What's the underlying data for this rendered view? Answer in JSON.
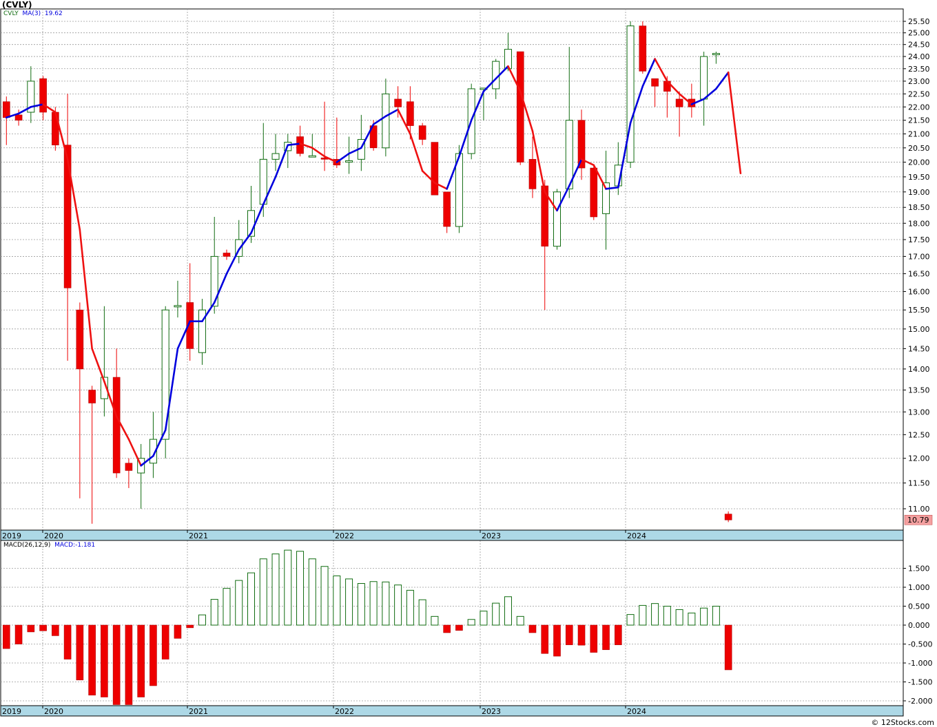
{
  "title": "(CVLY)",
  "credit": "© 12Stocks.com",
  "colors": {
    "up": "#0f6b0f",
    "down": "#ee0000",
    "ma_rising": "#0000dd",
    "ma_falling": "#ee1111",
    "axis_bar": "#add8e6",
    "price_box": "#f4a0a0"
  },
  "price_panel": {
    "legend_symbol": "CVLY",
    "legend_ma": "MA(3)",
    "legend_ma_value": "19.62",
    "last_price_label": "10.79",
    "y_ticks": [
      "25.50",
      "25.00",
      "24.50",
      "24.00",
      "23.50",
      "23.00",
      "22.50",
      "22.00",
      "21.50",
      "21.00",
      "20.50",
      "20.00",
      "19.50",
      "19.00",
      "18.50",
      "18.00",
      "17.50",
      "17.00",
      "16.50",
      "16.00",
      "15.50",
      "15.00",
      "14.50",
      "14.00",
      "13.50",
      "13.00",
      "12.50",
      "12.00",
      "11.50",
      "11.00"
    ]
  },
  "macd_panel": {
    "legend_name": "MACD(26,12,9)",
    "legend_value": "MACD:-1.181",
    "y_ticks": [
      "1.500",
      "1.000",
      "0.500",
      "0.000",
      "-0.500",
      "-1.000",
      "-1.500",
      "-2.000"
    ]
  },
  "x_labels": [
    "2019",
    "2020",
    "2021",
    "2022",
    "2023",
    "2024"
  ],
  "chart_data": {
    "type": "candlestick",
    "title": "(CVLY)",
    "price_scale": "log",
    "ylim": [
      10.7,
      25.8
    ],
    "candles": [
      {
        "o": 22.2,
        "h": 22.4,
        "l": 20.6,
        "c": 21.6
      },
      {
        "o": 21.7,
        "h": 21.9,
        "l": 21.3,
        "c": 21.5
      },
      {
        "o": 21.8,
        "h": 23.6,
        "l": 21.4,
        "c": 23.0
      },
      {
        "o": 23.1,
        "h": 23.2,
        "l": 21.5,
        "c": 21.8
      },
      {
        "o": 21.8,
        "h": 22.0,
        "l": 20.4,
        "c": 20.6
      },
      {
        "o": 20.6,
        "h": 22.5,
        "l": 14.2,
        "c": 16.1
      },
      {
        "o": 15.5,
        "h": 15.7,
        "l": 11.2,
        "c": 14.0
      },
      {
        "o": 13.5,
        "h": 13.6,
        "l": 10.2,
        "c": 13.2
      },
      {
        "o": 13.3,
        "h": 15.6,
        "l": 12.9,
        "c": 13.8
      },
      {
        "o": 13.8,
        "h": 14.5,
        "l": 11.6,
        "c": 11.7
      },
      {
        "o": 11.9,
        "h": 12.0,
        "l": 11.4,
        "c": 11.75
      },
      {
        "o": 11.7,
        "h": 12.3,
        "l": 11.0,
        "c": 12.0
      },
      {
        "o": 11.9,
        "h": 13.0,
        "l": 11.6,
        "c": 12.4
      },
      {
        "o": 12.4,
        "h": 15.6,
        "l": 12.0,
        "c": 15.5
      },
      {
        "o": 15.6,
        "h": 16.3,
        "l": 15.3,
        "c": 15.6
      },
      {
        "o": 15.7,
        "h": 16.8,
        "l": 14.2,
        "c": 14.5
      },
      {
        "o": 14.4,
        "h": 15.8,
        "l": 14.1,
        "c": 15.5
      },
      {
        "o": 15.6,
        "h": 18.2,
        "l": 15.4,
        "c": 17.0
      },
      {
        "o": 17.1,
        "h": 17.2,
        "l": 16.9,
        "c": 17.0
      },
      {
        "o": 17.0,
        "h": 18.1,
        "l": 16.8,
        "c": 17.5
      },
      {
        "o": 17.6,
        "h": 19.2,
        "l": 17.4,
        "c": 18.4
      },
      {
        "o": 18.6,
        "h": 21.4,
        "l": 18.2,
        "c": 20.1
      },
      {
        "o": 20.1,
        "h": 21.0,
        "l": 19.7,
        "c": 20.3
      },
      {
        "o": 20.4,
        "h": 21.0,
        "l": 19.8,
        "c": 20.7
      },
      {
        "o": 20.9,
        "h": 21.3,
        "l": 20.2,
        "c": 20.3
      },
      {
        "o": 20.2,
        "h": 21.0,
        "l": 20.2,
        "c": 20.2
      },
      {
        "o": 20.15,
        "h": 22.2,
        "l": 19.7,
        "c": 20.1
      },
      {
        "o": 20.1,
        "h": 21.6,
        "l": 19.8,
        "c": 19.9
      },
      {
        "o": 20.0,
        "h": 20.9,
        "l": 19.6,
        "c": 20.05
      },
      {
        "o": 20.1,
        "h": 21.7,
        "l": 19.7,
        "c": 20.8
      },
      {
        "o": 21.3,
        "h": 21.5,
        "l": 20.4,
        "c": 20.5
      },
      {
        "o": 20.5,
        "h": 23.1,
        "l": 20.2,
        "c": 22.5
      },
      {
        "o": 22.3,
        "h": 22.8,
        "l": 21.6,
        "c": 22.0
      },
      {
        "o": 22.2,
        "h": 22.8,
        "l": 20.8,
        "c": 21.3
      },
      {
        "o": 21.3,
        "h": 21.4,
        "l": 20.6,
        "c": 20.8
      },
      {
        "o": 20.7,
        "h": 20.7,
        "l": 18.9,
        "c": 18.9
      },
      {
        "o": 19.0,
        "h": 19.0,
        "l": 17.7,
        "c": 17.9
      },
      {
        "o": 17.9,
        "h": 20.6,
        "l": 17.7,
        "c": 20.3
      },
      {
        "o": 20.3,
        "h": 22.9,
        "l": 20.1,
        "c": 22.7
      },
      {
        "o": 22.7,
        "h": 22.7,
        "l": 21.5,
        "c": 22.7
      },
      {
        "o": 22.7,
        "h": 23.9,
        "l": 22.3,
        "c": 23.8
      },
      {
        "o": 23.5,
        "h": 25.0,
        "l": 23.4,
        "c": 24.3
      },
      {
        "o": 24.2,
        "h": 24.2,
        "l": 19.9,
        "c": 20.0
      },
      {
        "o": 20.1,
        "h": 20.9,
        "l": 18.8,
        "c": 19.1
      },
      {
        "o": 19.2,
        "h": 19.4,
        "l": 15.5,
        "c": 17.3
      },
      {
        "o": 17.3,
        "h": 19.1,
        "l": 17.2,
        "c": 19.0
      },
      {
        "o": 19.1,
        "h": 24.4,
        "l": 18.8,
        "c": 21.5
      },
      {
        "o": 21.5,
        "h": 21.9,
        "l": 19.4,
        "c": 19.8
      },
      {
        "o": 19.8,
        "h": 19.9,
        "l": 18.1,
        "c": 18.2
      },
      {
        "o": 18.3,
        "h": 20.4,
        "l": 17.2,
        "c": 19.3
      },
      {
        "o": 19.2,
        "h": 20.7,
        "l": 18.9,
        "c": 19.9
      },
      {
        "o": 20.0,
        "h": 25.5,
        "l": 19.8,
        "c": 25.3
      },
      {
        "o": 25.3,
        "h": 25.5,
        "l": 23.3,
        "c": 23.4
      },
      {
        "o": 23.1,
        "h": 23.1,
        "l": 22.0,
        "c": 22.8
      },
      {
        "o": 23.0,
        "h": 23.2,
        "l": 21.6,
        "c": 22.6
      },
      {
        "o": 22.3,
        "h": 22.6,
        "l": 20.9,
        "c": 22.0
      },
      {
        "o": 22.3,
        "h": 22.9,
        "l": 21.6,
        "c": 22.0
      },
      {
        "o": 22.3,
        "h": 24.2,
        "l": 21.3,
        "c": 24.0
      },
      {
        "o": 24.1,
        "h": 24.2,
        "l": 23.7,
        "c": 24.1
      },
      {
        "o": 10.9,
        "h": 10.95,
        "l": 10.75,
        "c": 10.79
      }
    ],
    "ma3": [
      21.6,
      21.75,
      22.0,
      22.1,
      21.8,
      20.1,
      17.8,
      14.5,
      13.7,
      12.9,
      12.4,
      11.85,
      12.05,
      12.6,
      14.5,
      15.2,
      15.2,
      15.7,
      16.5,
      17.2,
      17.7,
      18.6,
      19.5,
      20.6,
      20.65,
      20.5,
      20.2,
      20.0,
      20.3,
      20.5,
      21.35,
      21.65,
      21.9,
      21.0,
      19.7,
      19.3,
      19.1,
      20.2,
      21.5,
      22.6,
      23.1,
      23.6,
      22.6,
      21.1,
      19.0,
      18.4,
      19.2,
      20.1,
      19.9,
      19.1,
      19.15,
      21.4,
      22.8,
      23.9,
      23.0,
      22.5,
      22.1,
      22.3,
      22.7,
      23.35,
      19.62
    ],
    "macd_hist": [
      -0.62,
      -0.5,
      -0.18,
      -0.15,
      -0.28,
      -0.9,
      -1.45,
      -1.85,
      -1.9,
      -2.1,
      -2.1,
      -1.9,
      -1.6,
      -0.9,
      -0.35,
      -0.07,
      0.27,
      0.68,
      0.97,
      1.18,
      1.38,
      1.75,
      1.88,
      1.98,
      1.95,
      1.75,
      1.55,
      1.3,
      1.22,
      1.1,
      1.15,
      1.14,
      1.06,
      0.92,
      0.67,
      0.23,
      -0.2,
      -0.14,
      0.15,
      0.37,
      0.58,
      0.75,
      0.23,
      -0.2,
      -0.75,
      -0.82,
      -0.52,
      -0.53,
      -0.72,
      -0.65,
      -0.52,
      0.28,
      0.52,
      0.57,
      0.5,
      0.41,
      0.32,
      0.45,
      0.5,
      -1.181
    ]
  }
}
